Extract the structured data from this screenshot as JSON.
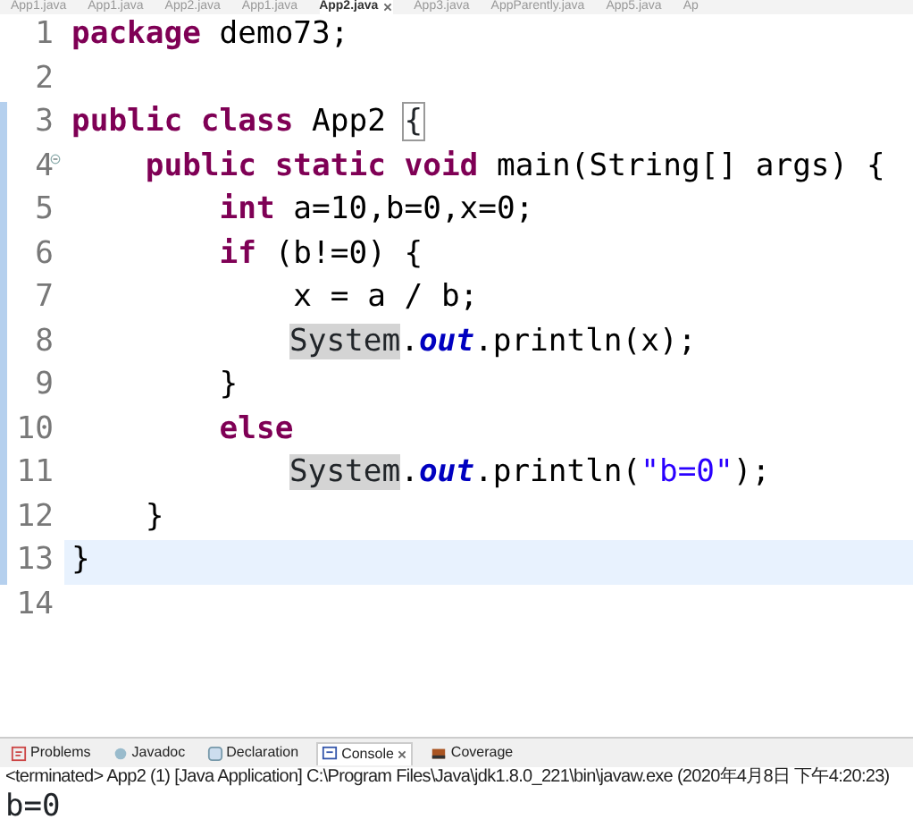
{
  "editor_tabs": [
    {
      "label": "App1.java",
      "selected": false
    },
    {
      "label": "App1.java",
      "selected": false
    },
    {
      "label": "App2.java",
      "selected": false
    },
    {
      "label": "App1.java",
      "selected": false
    },
    {
      "label": "App2.java",
      "selected": true
    },
    {
      "label": "App3.java",
      "selected": false
    },
    {
      "label": "AppParently.java",
      "selected": false
    },
    {
      "label": "App5.java",
      "selected": false
    },
    {
      "label": "Ap",
      "selected": false
    }
  ],
  "code_lines": [
    {
      "number": "1",
      "changed": false,
      "current": false,
      "collapsible": false,
      "tokens": [
        {
          "kind": "keyword",
          "text": "package"
        },
        {
          "kind": "plain",
          "text": " demo73;"
        }
      ]
    },
    {
      "number": "2",
      "changed": false,
      "current": false,
      "collapsible": false
    },
    {
      "number": "3",
      "changed": true,
      "current": false,
      "collapsible": false,
      "tokens": [
        {
          "kind": "keyword",
          "text": "public class"
        },
        {
          "kind": "plain",
          "text": " App2 "
        },
        {
          "kind": "bracket",
          "text": "{"
        }
      ]
    },
    {
      "number": "4",
      "changed": true,
      "current": false,
      "collapsible": true,
      "tokens": [
        {
          "kind": "keyword",
          "text": "    public static void"
        },
        {
          "kind": "plain",
          "text": " main(String[] args) {"
        }
      ]
    },
    {
      "number": "5",
      "changed": true,
      "current": false,
      "collapsible": false,
      "tokens": [
        {
          "kind": "keyword",
          "text": "        int"
        },
        {
          "kind": "plain",
          "text": " a=10,b=0,x=0;"
        }
      ]
    },
    {
      "number": "6",
      "changed": true,
      "current": false,
      "collapsible": false,
      "tokens": [
        {
          "kind": "keyword",
          "text": "        if"
        },
        {
          "kind": "plain",
          "text": " (b!=0) {"
        }
      ]
    },
    {
      "number": "7",
      "changed": true,
      "current": false,
      "collapsible": false,
      "tokens": [
        {
          "kind": "plain",
          "text": "            x = a / b;"
        }
      ]
    },
    {
      "number": "8",
      "changed": true,
      "current": false,
      "collapsible": false,
      "indent": true,
      "tokens": [
        {
          "kind": "occurrence",
          "text": "System"
        },
        {
          "kind": "plain",
          "text": "."
        },
        {
          "kind": "field",
          "text": "out"
        },
        {
          "kind": "plain",
          "text": ".println(x);"
        }
      ]
    },
    {
      "number": "9",
      "changed": true,
      "current": false,
      "collapsible": false,
      "tokens": [
        {
          "kind": "plain",
          "text": "        }"
        }
      ]
    },
    {
      "number": "10",
      "changed": true,
      "current": false,
      "collapsible": false,
      "tokens": [
        {
          "kind": "keyword",
          "text": "        else"
        }
      ]
    },
    {
      "number": "11",
      "changed": true,
      "current": false,
      "collapsible": false,
      "indent": true,
      "tokens": [
        {
          "kind": "occurrence",
          "text": "System"
        },
        {
          "kind": "plain",
          "text": "."
        },
        {
          "kind": "field",
          "text": "out"
        },
        {
          "kind": "plain",
          "text": ".println("
        },
        {
          "kind": "string",
          "text": "\"b=0\""
        },
        {
          "kind": "plain",
          "text": ");"
        }
      ]
    },
    {
      "number": "12",
      "changed": true,
      "current": false,
      "collapsible": false,
      "tokens": [
        {
          "kind": "plain",
          "text": "    }"
        }
      ]
    },
    {
      "number": "13",
      "changed": true,
      "current": true,
      "collapsible": false,
      "tokens": [
        {
          "kind": "plain",
          "text": "}"
        }
      ]
    },
    {
      "number": "14",
      "changed": false,
      "current": false,
      "collapsible": false
    }
  ],
  "panel_tabs": [
    {
      "label": "Problems",
      "selected": false
    },
    {
      "label": "Javadoc",
      "selected": false
    },
    {
      "label": "Declaration",
      "selected": false
    },
    {
      "label": "Console",
      "selected": true
    },
    {
      "label": "Coverage",
      "selected": false
    }
  ],
  "console": {
    "header": "<terminated> App2 (1) [Java Application] C:\\Program Files\\Java\\jdk1.8.0_221\\bin\\javaw.exe (2020年4月8日 下午4:20:23)",
    "output": "b=0"
  }
}
